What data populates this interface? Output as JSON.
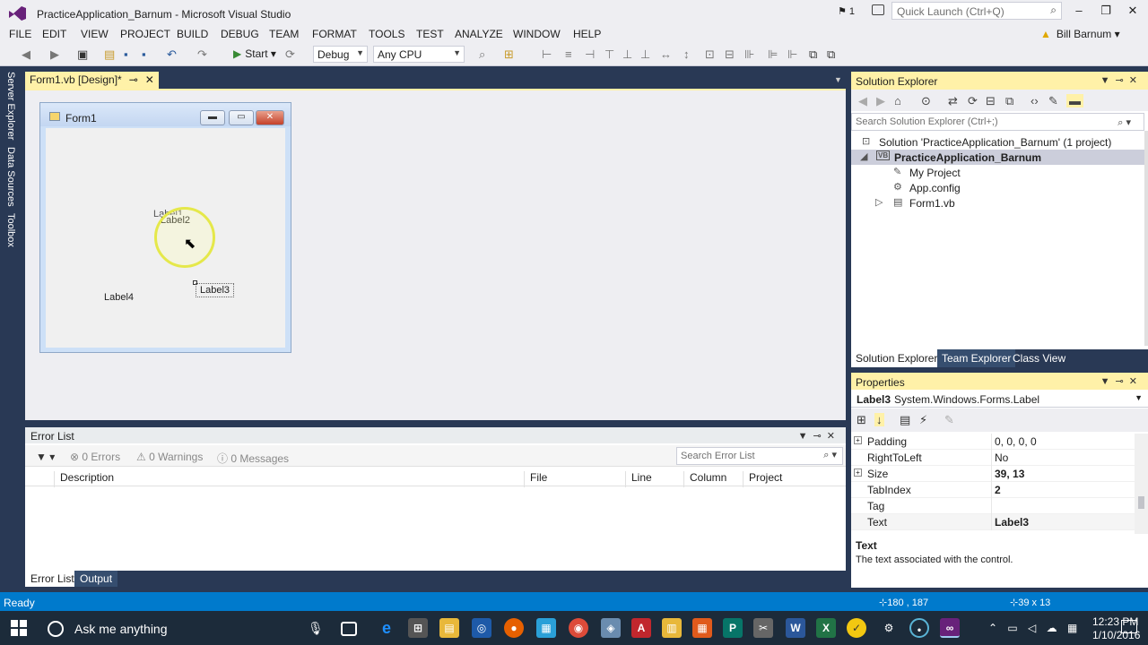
{
  "window": {
    "title": "PracticeApplication_Barnum - Microsoft Visual Studio",
    "notification_count": "1",
    "quick_launch_placeholder": "Quick Launch (Ctrl+Q)",
    "user_name": "Bill Barnum",
    "controls": [
      "–",
      "❐",
      "✕"
    ]
  },
  "menu": [
    "FILE",
    "EDIT",
    "VIEW",
    "PROJECT",
    "BUILD",
    "DEBUG",
    "TEAM",
    "FORMAT",
    "TOOLS",
    "TEST",
    "ANALYZE",
    "WINDOW",
    "HELP"
  ],
  "toolbar": {
    "start_label": "Start",
    "config": "Debug",
    "platform": "Any CPU"
  },
  "side_tabs": [
    "Server Explorer",
    "Data Sources",
    "Toolbox"
  ],
  "document_tab": {
    "label": "Form1.vb [Design]*",
    "pin": "⊸",
    "close": "✕"
  },
  "form": {
    "title": "Form1",
    "labels": [
      {
        "id": "label1",
        "text": "Label1"
      },
      {
        "id": "label2",
        "text": "Label2"
      },
      {
        "id": "label3",
        "text": "Label3"
      },
      {
        "id": "label4",
        "text": "Label4"
      }
    ]
  },
  "error_list": {
    "title": "Error List",
    "errors": "0 Errors",
    "warnings": "0 Warnings",
    "messages": "0 Messages",
    "search_placeholder": "Search Error List",
    "columns": [
      "Description",
      "File",
      "Line",
      "Column",
      "Project"
    ]
  },
  "bottom_tabs": [
    "Error List",
    "Output"
  ],
  "solution_explorer": {
    "title": "Solution Explorer",
    "search_placeholder": "Search Solution Explorer (Ctrl+;)",
    "tree": [
      {
        "text": "Solution 'PracticeApplication_Barnum' (1 project)",
        "icon": "solution-icon"
      },
      {
        "text": "PracticeApplication_Barnum",
        "icon": "vb-project-icon"
      },
      {
        "text": "My Project",
        "icon": "wrench-icon"
      },
      {
        "text": "App.config",
        "icon": "config-icon"
      },
      {
        "text": "Form1.vb",
        "icon": "form-icon"
      }
    ],
    "tabs": [
      "Solution Explorer",
      "Team Explorer",
      "Class View"
    ]
  },
  "properties": {
    "title": "Properties",
    "object_name": "Label3",
    "object_type": "System.Windows.Forms.Label",
    "rows": [
      {
        "name": "Padding",
        "value": "0, 0, 0, 0",
        "expandable": true,
        "bold": false
      },
      {
        "name": "RightToLeft",
        "value": "No",
        "expandable": false,
        "bold": false
      },
      {
        "name": "Size",
        "value": "39, 13",
        "expandable": true,
        "bold": true
      },
      {
        "name": "TabIndex",
        "value": "2",
        "expandable": false,
        "bold": true
      },
      {
        "name": "Tag",
        "value": "",
        "expandable": false,
        "bold": false
      },
      {
        "name": "Text",
        "value": "Label3",
        "expandable": false,
        "bold": true
      }
    ],
    "desc_title": "Text",
    "desc_text": "The text associated with the control."
  },
  "status": {
    "ready": "Ready",
    "position": "180 , 187",
    "size": "39 x 13"
  },
  "taskbar": {
    "search_placeholder": "Ask me anything",
    "time": "12:23 PM",
    "date": "1/10/2016"
  },
  "colors": {
    "accent": "#007acc",
    "active_tab": "#fff1a8",
    "vs_purple": "#68217a"
  }
}
